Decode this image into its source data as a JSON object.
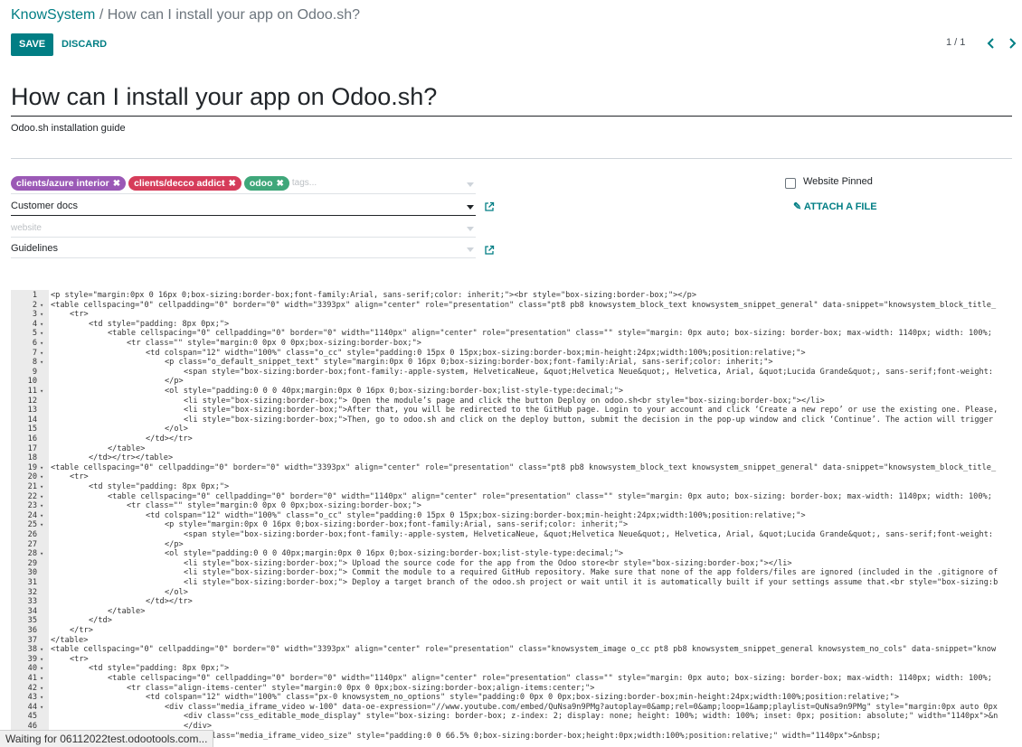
{
  "breadcrumb": {
    "root": "KnowSystem",
    "separator": " / ",
    "current": "How can I install your app on Odoo.sh?"
  },
  "toolbar": {
    "save_label": "SAVE",
    "discard_label": "DISCARD"
  },
  "pager": {
    "value": "1 / 1"
  },
  "form": {
    "title": "How can I install your app on Odoo.sh?",
    "subtitle": "Odoo.sh installation guide",
    "tags": [
      {
        "label": "clients/azure interior",
        "color": "#9b59b6"
      },
      {
        "label": "clients/decco addict",
        "color": "#d63c5a"
      },
      {
        "label": "odoo",
        "color": "#3fa77a"
      }
    ],
    "tags_placeholder": "tags...",
    "section_value": "Customer docs",
    "website_placeholder": "website",
    "category_value": "Guidelines",
    "website_pinned_label": "Website Pinned",
    "attach_label": "ATTACH A FILE"
  },
  "colors": {
    "accent": "#017e84"
  },
  "editor": {
    "lines": [
      {
        "n": "1",
        "f": "",
        "i": 0,
        "t": "<p style=\"margin:0px 0 16px 0;box-sizing:border-box;font-family:Arial, sans-serif;color: inherit;\"><br style=\"box-sizing:border-box;\"></p>"
      },
      {
        "n": "2",
        "f": "▾",
        "i": 0,
        "t": "<table cellspacing=\"0\" cellpadding=\"0\" border=\"0\" width=\"3393px\" align=\"center\" role=\"presentation\" class=\"pt8 pb8 knowsystem_block_text knowsystem_snippet_general\" data-snippet=\"knowsystem_block_title_"
      },
      {
        "n": "3",
        "f": "▾",
        "i": 1,
        "t": "<tr>"
      },
      {
        "n": "4",
        "f": "▾",
        "i": 2,
        "t": "<td style=\"padding: 8px 0px;\">"
      },
      {
        "n": "5",
        "f": "▾",
        "i": 3,
        "t": "<table cellspacing=\"0\" cellpadding=\"0\" border=\"0\" width=\"1140px\" align=\"center\" role=\"presentation\" class=\"\" style=\"margin: 0px auto; box-sizing: border-box; max-width: 1140px; width: 100%;"
      },
      {
        "n": "6",
        "f": "▾",
        "i": 4,
        "t": "<tr class=\"\" style=\"margin:0 0px 0 0px;box-sizing:border-box;\">"
      },
      {
        "n": "7",
        "f": "▾",
        "i": 5,
        "t": "<td colspan=\"12\" width=\"100%\" class=\"o_cc\" style=\"padding:0 15px 0 15px;box-sizing:border-box;min-height:24px;width:100%;position:relative;\">"
      },
      {
        "n": "8",
        "f": "▾",
        "i": 6,
        "t": "<p class=\"o_default_snippet_text\" style=\"margin:0px 0 16px 0;box-sizing:border-box;font-family:Arial, sans-serif;color: inherit;\">"
      },
      {
        "n": "9",
        "f": "",
        "i": 7,
        "t": "<span style=\"box-sizing:border-box;font-family:-apple-system, HelveticaNeue, &quot;Helvetica Neue&quot;, Helvetica, Arial, &quot;Lucida Grande&quot;, sans-serif;font-weight:"
      },
      {
        "n": "10",
        "f": "",
        "i": 6,
        "t": "</p>"
      },
      {
        "n": "11",
        "f": "▾",
        "i": 6,
        "t": "<ol style=\"padding:0 0 0 40px;margin:0px 0 16px 0;box-sizing:border-box;list-style-type:decimal;\">"
      },
      {
        "n": "12",
        "f": "",
        "i": 7,
        "t": "<li style=\"box-sizing:border-box;\"> Open the module’s page and click the button Deploy on odoo.sh<br style=\"box-sizing:border-box;\"></li>"
      },
      {
        "n": "13",
        "f": "",
        "i": 7,
        "t": "<li style=\"box-sizing:border-box;\">After that, you will be redirected to the GitHub page. Login to your account and click ‘Create a new repo’ or use the existing one. Please,"
      },
      {
        "n": "14",
        "f": "",
        "i": 7,
        "t": "<li style=\"box-sizing:border-box;\">Then, go to odoo.sh and click on the deploy button, submit the decision in the pop-up window and click ‘Continue’. The action will trigger"
      },
      {
        "n": "15",
        "f": "",
        "i": 6,
        "t": "</ol>"
      },
      {
        "n": "16",
        "f": "",
        "i": 5,
        "t": "</td></tr>"
      },
      {
        "n": "17",
        "f": "",
        "i": 3,
        "t": "</table>"
      },
      {
        "n": "18",
        "f": "",
        "i": 2,
        "t": "</td></tr></table>"
      },
      {
        "n": "19",
        "f": "▾",
        "i": 0,
        "t": "<table cellspacing=\"0\" cellpadding=\"0\" border=\"0\" width=\"3393px\" align=\"center\" role=\"presentation\" class=\"pt8 pb8 knowsystem_block_text knowsystem_snippet_general\" data-snippet=\"knowsystem_block_title_"
      },
      {
        "n": "20",
        "f": "▾",
        "i": 1,
        "t": "<tr>"
      },
      {
        "n": "21",
        "f": "▾",
        "i": 2,
        "t": "<td style=\"padding: 8px 0px;\">"
      },
      {
        "n": "22",
        "f": "▾",
        "i": 3,
        "t": "<table cellspacing=\"0\" cellpadding=\"0\" border=\"0\" width=\"1140px\" align=\"center\" role=\"presentation\" class=\"\" style=\"margin: 0px auto; box-sizing: border-box; max-width: 1140px; width: 100%;"
      },
      {
        "n": "23",
        "f": "▾",
        "i": 4,
        "t": "<tr class=\"\" style=\"margin:0 0px 0 0px;box-sizing:border-box;\">"
      },
      {
        "n": "24",
        "f": "▾",
        "i": 5,
        "t": "<td colspan=\"12\" width=\"100%\" class=\"o_cc\" style=\"padding:0 15px 0 15px;box-sizing:border-box;min-height:24px;width:100%;position:relative;\">"
      },
      {
        "n": "25",
        "f": "▾",
        "i": 6,
        "t": "<p style=\"margin:0px 0 16px 0;box-sizing:border-box;font-family:Arial, sans-serif;color: inherit;\">"
      },
      {
        "n": "26",
        "f": "",
        "i": 7,
        "t": "<span style=\"box-sizing:border-box;font-family:-apple-system, HelveticaNeue, &quot;Helvetica Neue&quot;, Helvetica, Arial, &quot;Lucida Grande&quot;, sans-serif;font-weight:"
      },
      {
        "n": "27",
        "f": "",
        "i": 6,
        "t": "</p>"
      },
      {
        "n": "28",
        "f": "▾",
        "i": 6,
        "t": "<ol style=\"padding:0 0 0 40px;margin:0px 0 16px 0;box-sizing:border-box;list-style-type:decimal;\">"
      },
      {
        "n": "29",
        "f": "",
        "i": 7,
        "t": "<li style=\"box-sizing:border-box;\"> Upload the source code for the app from the Odoo store<br style=\"box-sizing:border-box;\"></li>"
      },
      {
        "n": "30",
        "f": "",
        "i": 7,
        "t": "<li style=\"box-sizing:border-box;\"> Commit the module to a required GitHub repository. Make sure that none of the app folders/files are ignored (included in the .gitignore of"
      },
      {
        "n": "31",
        "f": "",
        "i": 7,
        "t": "<li style=\"box-sizing:border-box;\"> Deploy a target branch of the odoo.sh project or wait until it is automatically built if your settings assume that.<br style=\"box-sizing:b"
      },
      {
        "n": "32",
        "f": "",
        "i": 6,
        "t": "</ol>"
      },
      {
        "n": "33",
        "f": "",
        "i": 5,
        "t": "</td></tr>"
      },
      {
        "n": "34",
        "f": "",
        "i": 3,
        "t": "</table>"
      },
      {
        "n": "35",
        "f": "",
        "i": 2,
        "t": "</td>"
      },
      {
        "n": "36",
        "f": "",
        "i": 1,
        "t": "</tr>"
      },
      {
        "n": "37",
        "f": "",
        "i": 0,
        "t": "</table>"
      },
      {
        "n": "38",
        "f": "▾",
        "i": 0,
        "t": "<table cellspacing=\"0\" cellpadding=\"0\" border=\"0\" width=\"3393px\" align=\"center\" role=\"presentation\" class=\"knowsystem_image o_cc pt8 pb8 knowsystem_snippet_general knowsystem_no_cols\" data-snippet=\"know"
      },
      {
        "n": "39",
        "f": "▾",
        "i": 1,
        "t": "<tr>"
      },
      {
        "n": "40",
        "f": "▾",
        "i": 2,
        "t": "<td style=\"padding: 8px 0px;\">"
      },
      {
        "n": "41",
        "f": "▾",
        "i": 3,
        "t": "<table cellspacing=\"0\" cellpadding=\"0\" border=\"0\" width=\"1140px\" align=\"center\" role=\"presentation\" class=\"\" style=\"margin: 0px auto; box-sizing: border-box; max-width: 1140px; width: 100%;"
      },
      {
        "n": "42",
        "f": "▾",
        "i": 4,
        "t": "<tr class=\"align-items-center\" style=\"margin:0 0px 0 0px;box-sizing:border-box;align-items:center;\">"
      },
      {
        "n": "43",
        "f": "▾",
        "i": 5,
        "t": "<td colspan=\"12\" width=\"100%\" class=\"px-0 knowsystem_no_options\" style=\"padding:0 0px 0 0px;box-sizing:border-box;min-height:24px;width:100%;position:relative;\">"
      },
      {
        "n": "44",
        "f": "▾",
        "i": 6,
        "t": "<div class=\"media_iframe_video w-100\" data-oe-expression=\"//www.youtube.com/embed/QuNsa9n9PMg?autoplay=0&amp;rel=0&amp;loop=1&amp;playlist=QuNsa9n9PMg\" style=\"margin:0px auto 0px"
      },
      {
        "n": "45",
        "f": "",
        "i": 7,
        "t": "<div class=\"css_editable_mode_display\" style=\"box-sizing: border-box; z-index: 2; display: none; height: 100%; width: 100%; inset: 0px; position: absolute;\" width=\"1140px\">&n"
      },
      {
        "n": "46",
        "f": "",
        "i": 7,
        "t": "</div>"
      },
      {
        "n": "47",
        "f": "",
        "i": 7,
        "t": "<div class=\"media_iframe_video_size\" style=\"padding:0 0 66.5% 0;box-sizing:border-box;height:0px;width:100%;position:relative;\" width=\"1140px\">&nbsp;"
      }
    ]
  },
  "status_bar": {
    "text": "Waiting for 06112022test.odootools.com..."
  }
}
